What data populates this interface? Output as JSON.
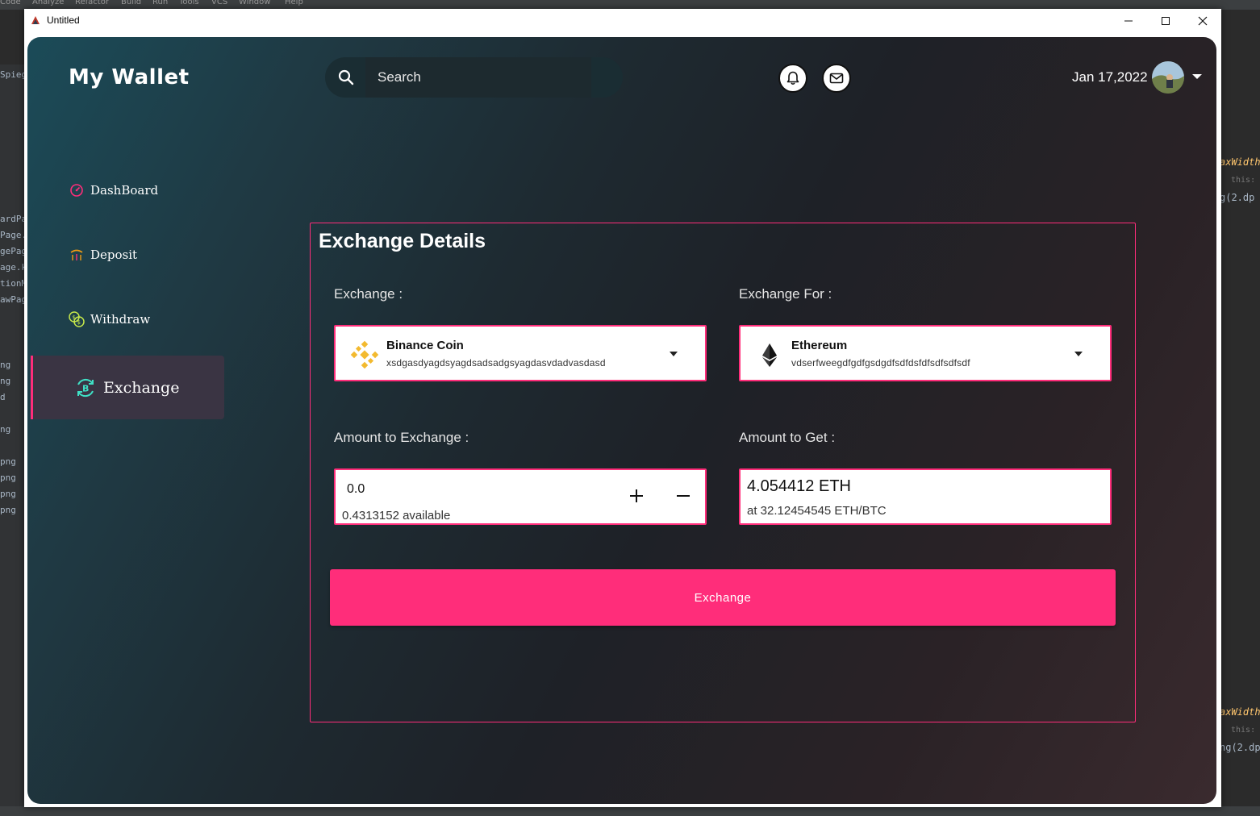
{
  "ide": {
    "menu": [
      "Code",
      "Analyze",
      "Refactor",
      "Build",
      "Run",
      "Tools",
      "VCS",
      "Window",
      "Help"
    ],
    "left_fragments": [
      "Spiege",
      "ardPa",
      "Page.",
      "gePag",
      "age.k",
      "tionM",
      "awPag",
      "ng",
      "ng",
      "d",
      "ng",
      "png",
      "png",
      "png",
      "png"
    ],
    "right_fragments": [
      "axWidth",
      "this: Ro",
      "g(2.dp",
      "axWidth",
      "this: Ro",
      "ng(2.dp"
    ]
  },
  "window": {
    "title": "Untitled",
    "minimize": "─",
    "maximize": "☐",
    "close": "✕"
  },
  "app": {
    "brand": "My Wallet",
    "search": {
      "placeholder": "Search"
    },
    "date": "Jan 17,2022",
    "nav": [
      {
        "label": "DashBoard",
        "icon": "dashboard-icon"
      },
      {
        "label": "Deposit",
        "icon": "deposit-icon"
      },
      {
        "label": "Withdraw",
        "icon": "withdraw-icon"
      },
      {
        "label": "Exchange",
        "icon": "exchange-icon",
        "active": true
      }
    ]
  },
  "panel": {
    "title": "Exchange Details",
    "exchange_label": "Exchange :",
    "exchange_for_label": "Exchange For :",
    "from_coin": {
      "name": "Binance Coin",
      "address": "xsdgasdyagdsyagdsadsadgsyagdasvdadvasdasd",
      "icon": "binance-coin-icon"
    },
    "to_coin": {
      "name": "Ethereum",
      "address": "vdserfweegdfgdfgsdgdfsdfdsfdfsdfsdfsdf",
      "icon": "ethereum-icon"
    },
    "amount_label": "Amount to Exchange :",
    "amount_value": "0.0",
    "amount_available": "0.4313152 available",
    "get_label": "Amount to Get :",
    "get_value": "4.054412 ETH",
    "get_rate": "at 32.12454545 ETH/BTC",
    "button_label": "Exchange"
  },
  "colors": {
    "accent": "#ff2d7a",
    "binance": "#f3ba2f",
    "text": "#ffffff"
  }
}
